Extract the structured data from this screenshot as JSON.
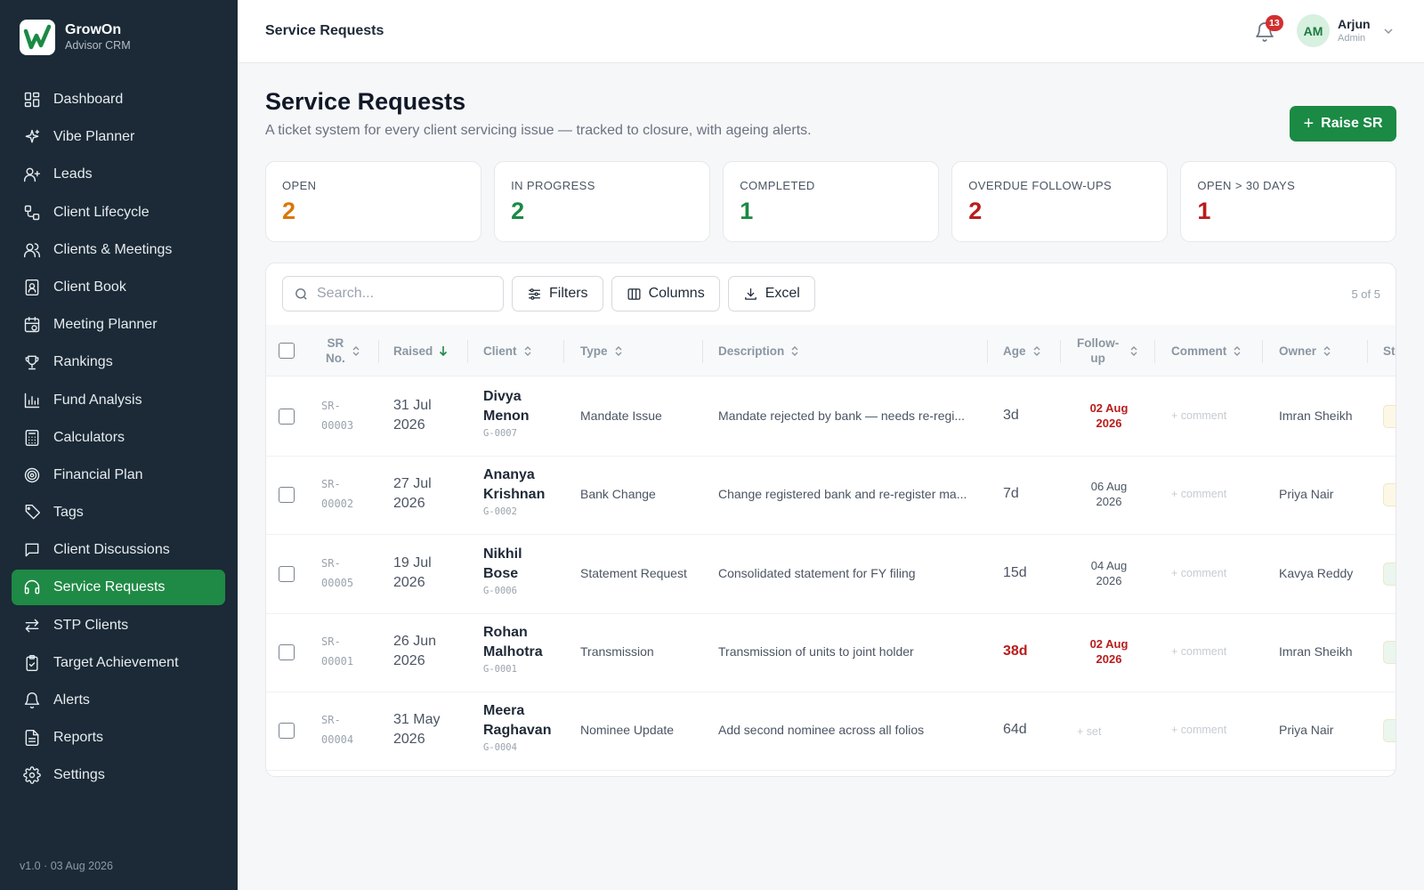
{
  "brand": {
    "name": "GrowOn",
    "subtitle": "Advisor CRM"
  },
  "nav": [
    {
      "label": "Dashboard",
      "icon": "dashboard-icon"
    },
    {
      "label": "Vibe Planner",
      "icon": "sparkle-icon"
    },
    {
      "label": "Leads",
      "icon": "user-plus-icon"
    },
    {
      "label": "Client Lifecycle",
      "icon": "lifecycle-icon"
    },
    {
      "label": "Clients & Meetings",
      "icon": "users-icon"
    },
    {
      "label": "Client Book",
      "icon": "book-icon"
    },
    {
      "label": "Meeting Planner",
      "icon": "calendar-icon"
    },
    {
      "label": "Rankings",
      "icon": "trophy-icon"
    },
    {
      "label": "Fund Analysis",
      "icon": "bar-chart-icon"
    },
    {
      "label": "Calculators",
      "icon": "calculator-icon"
    },
    {
      "label": "Financial Plan",
      "icon": "target-icon"
    },
    {
      "label": "Tags",
      "icon": "tag-icon"
    },
    {
      "label": "Client Discussions",
      "icon": "message-icon"
    },
    {
      "label": "Service Requests",
      "icon": "headset-icon",
      "active": true
    },
    {
      "label": "STP Clients",
      "icon": "transfer-icon"
    },
    {
      "label": "Target Achievement",
      "icon": "clipboard-check-icon"
    },
    {
      "label": "Alerts",
      "icon": "bell-icon"
    },
    {
      "label": "Reports",
      "icon": "file-icon"
    },
    {
      "label": "Settings",
      "icon": "gear-icon"
    }
  ],
  "version": "v1.0 · 03 Aug 2026",
  "topbar": {
    "title": "Service Requests",
    "notifications": "13",
    "user": {
      "initials": "AM",
      "name": "Arjun",
      "role": "Admin"
    }
  },
  "header": {
    "title": "Service Requests",
    "subtitle": "A ticket system for every client servicing issue — tracked to closure, with ageing alerts.",
    "raise_label": "Raise SR"
  },
  "stats": [
    {
      "label": "OPEN",
      "value": "2",
      "color": "#d97706"
    },
    {
      "label": "IN PROGRESS",
      "value": "2",
      "color": "#1a8a44"
    },
    {
      "label": "COMPLETED",
      "value": "1",
      "color": "#1a8a44"
    },
    {
      "label": "OVERDUE FOLLOW-UPS",
      "value": "2",
      "color": "#b91c1c"
    },
    {
      "label": "OPEN > 30 DAYS",
      "value": "1",
      "color": "#b91c1c"
    }
  ],
  "toolbar": {
    "search_placeholder": "Search...",
    "filters": "Filters",
    "columns": "Columns",
    "excel": "Excel",
    "count": "5 of 5"
  },
  "columns": {
    "sr_1": "SR",
    "sr_2": "No.",
    "raised": "Raised",
    "client": "Client",
    "type": "Type",
    "description": "Description",
    "age": "Age",
    "followup_1": "Follow-",
    "followup_2": "up",
    "comment": "Comment",
    "owner": "Owner",
    "status": "St"
  },
  "rows": [
    {
      "sr_1": "SR-",
      "sr_2": "00003",
      "raised_1": "31 Jul",
      "raised_2": "2026",
      "client_1": "Divya",
      "client_2": "Menon",
      "code": "G-0007",
      "type": "Mandate Issue",
      "description": "Mandate rejected by bank — needs re-regi...",
      "age": "3d",
      "age_alert": false,
      "fu_1": "02 Aug",
      "fu_2": "2026",
      "fu_overdue": true,
      "comment": "+ comment",
      "owner": "Imran Sheikh",
      "status_color": "#fdf8e6"
    },
    {
      "sr_1": "SR-",
      "sr_2": "00002",
      "raised_1": "27 Jul",
      "raised_2": "2026",
      "client_1": "Ananya",
      "client_2": "Krishnan",
      "code": "G-0002",
      "type": "Bank Change",
      "description": "Change registered bank and re-register ma...",
      "age": "7d",
      "age_alert": false,
      "fu_1": "06 Aug",
      "fu_2": "2026",
      "fu_overdue": false,
      "comment": "+ comment",
      "owner": "Priya Nair",
      "status_color": "#fdf8e6"
    },
    {
      "sr_1": "SR-",
      "sr_2": "00005",
      "raised_1": "19 Jul",
      "raised_2": "2026",
      "client_1": "Nikhil",
      "client_2": "Bose",
      "code": "G-0006",
      "type": "Statement Request",
      "description": "Consolidated statement for FY filing",
      "age": "15d",
      "age_alert": false,
      "fu_1": "04 Aug",
      "fu_2": "2026",
      "fu_overdue": false,
      "comment": "+ comment",
      "owner": "Kavya Reddy",
      "status_color": "#eaf6ee"
    },
    {
      "sr_1": "SR-",
      "sr_2": "00001",
      "raised_1": "26 Jun",
      "raised_2": "2026",
      "client_1": "Rohan",
      "client_2": "Malhotra",
      "code": "G-0001",
      "type": "Transmission",
      "description": "Transmission of units to joint holder",
      "age": "38d",
      "age_alert": true,
      "fu_1": "02 Aug",
      "fu_2": "2026",
      "fu_overdue": true,
      "comment": "+ comment",
      "owner": "Imran Sheikh",
      "status_color": "#eaf6ee"
    },
    {
      "sr_1": "SR-",
      "sr_2": "00004",
      "raised_1": "31 May",
      "raised_2": "2026",
      "client_1": "Meera",
      "client_2": "Raghavan",
      "code": "G-0004",
      "type": "Nominee Update",
      "description": "Add second nominee across all folios",
      "age": "64d",
      "age_alert": false,
      "fu_1": "+ set",
      "fu_2": "",
      "fu_unset": true,
      "fu_overdue": false,
      "comment": "+ comment",
      "owner": "Priya Nair",
      "status_color": "#eaf6ee"
    }
  ]
}
